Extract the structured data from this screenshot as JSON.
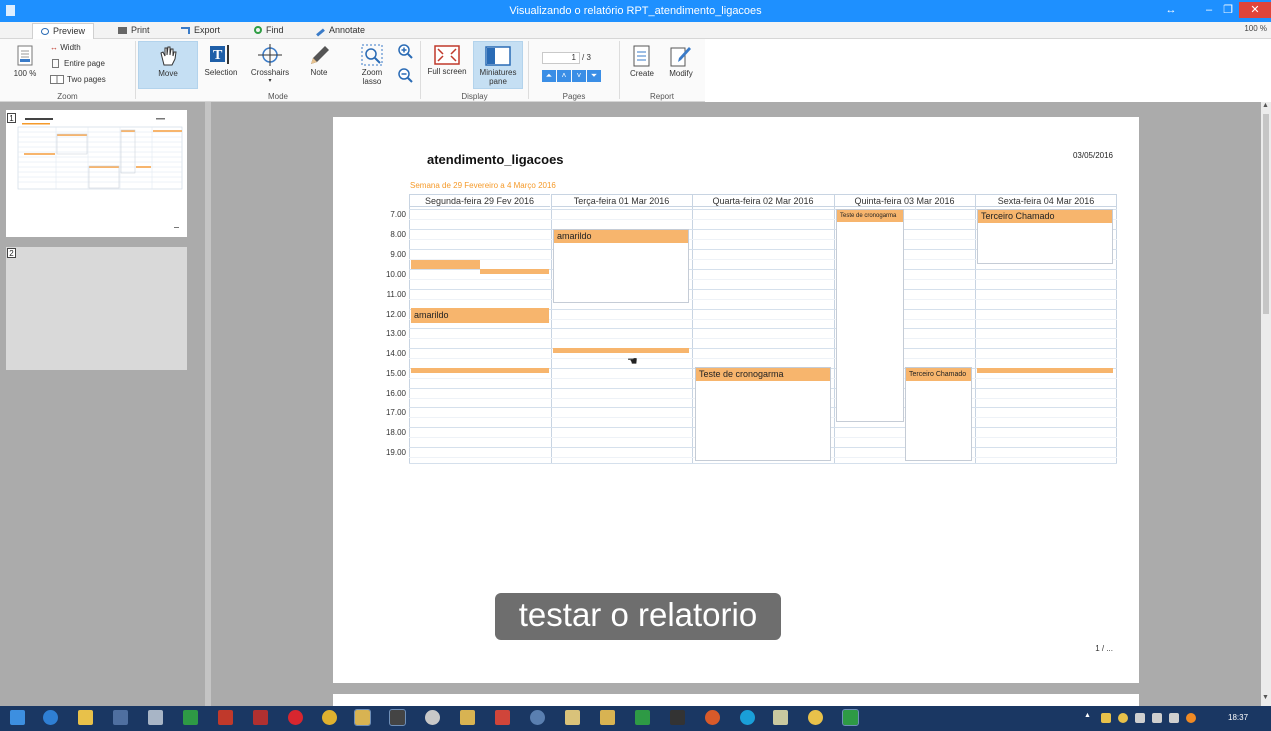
{
  "window": {
    "title": "Visualizando o relatório RPT_atendimento_ligacoes",
    "zoom_right": "100 %"
  },
  "tabs": [
    "Preview",
    "Print",
    "Export",
    "Find",
    "Annotate"
  ],
  "ribbon": {
    "zoom": {
      "percent": "100 %",
      "width": "Width",
      "entire_page": "Entire page",
      "two_pages": "Two pages",
      "group": "Zoom"
    },
    "mode": {
      "move": "Move",
      "selection": "Selection",
      "crosshairs": "Crosshairs",
      "note": "Note",
      "zoom_lasso_1": "Zoom",
      "zoom_lasso_2": "lasso",
      "group": "Mode"
    },
    "display": {
      "full_screen": "Full screen",
      "miniatures_1": "Miniatures",
      "miniatures_2": "pane",
      "group": "Display"
    },
    "pages": {
      "current": "1",
      "total": "/ 3",
      "group": "Pages"
    },
    "report": {
      "create": "Create",
      "modify": "Modify",
      "group": "Report"
    }
  },
  "thumbnails": [
    "1",
    "2"
  ],
  "report": {
    "title": "atendimento_ligacoes",
    "date": "03/05/2016",
    "week": "Semana de  29 Fevereiro  a 4 Março 2016",
    "footer": "1 / ...",
    "days": [
      "Segunda-feira 29 Fev 2016",
      "Terça-feira 01 Mar 2016",
      "Quarta-feira 02 Mar 2016",
      "Quinta-feira 03 Mar 2016",
      "Sexta-feira 04 Mar 2016"
    ],
    "hours": [
      "7.00",
      "8.00",
      "9.00",
      "10.00",
      "11.00",
      "12.00",
      "13.00",
      "14.00",
      "15.00",
      "16.00",
      "17.00",
      "18.00",
      "19.00"
    ],
    "events": {
      "mon_amarildo": "amarildo",
      "tue_amarildo": "amarildo",
      "wed_teste": "Teste de cronogarma",
      "thu_teste": "Teste de cronogarma",
      "thu_terceiro": "Terceiro Chamado",
      "fri_terceiro": "Terceiro Chamado"
    }
  },
  "caption": "testar o relatorio",
  "taskbar": {
    "clock": "18:37"
  },
  "colors": {
    "titlebar": "#1e90ff",
    "event": "#f7b56d",
    "week_text": "#f59a2a",
    "taskbar": "#1a3763"
  }
}
